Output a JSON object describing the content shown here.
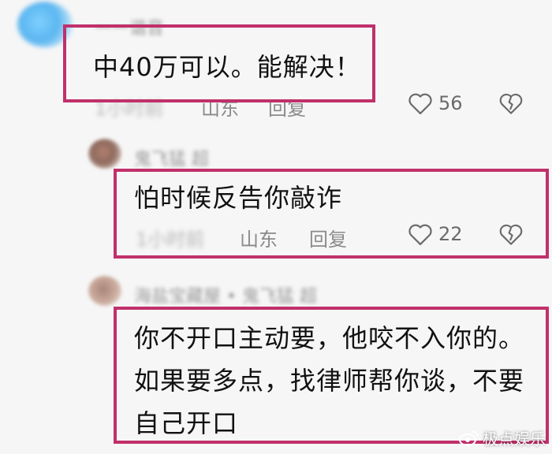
{
  "comments": [
    {
      "username": "一一谐音",
      "text": "中40万可以。能解决！",
      "time": "1小时前",
      "location": "山东",
      "reply_label": "回复",
      "likes": "56"
    },
    {
      "username": "鬼飞猛 超",
      "text": "怕时候反告你敲诈",
      "time": "1小时前",
      "location": "山东",
      "reply_label": "回复",
      "likes": "22"
    },
    {
      "username": "海盐宝藏屋 • 鬼飞猛 超",
      "text_lines": [
        "你不开口主动要，他咬不入你的。",
        "如果要多点，找律师帮你谈，不要",
        "自己开口"
      ]
    }
  ],
  "watermark": "极点娱乐",
  "colors": {
    "highlight": "#c0306b",
    "meta_text": "#8a8a8a",
    "comment_text": "#111111"
  },
  "icons": [
    "heart-outline-icon",
    "broken-heart-icon",
    "weibo-logo-icon"
  ]
}
